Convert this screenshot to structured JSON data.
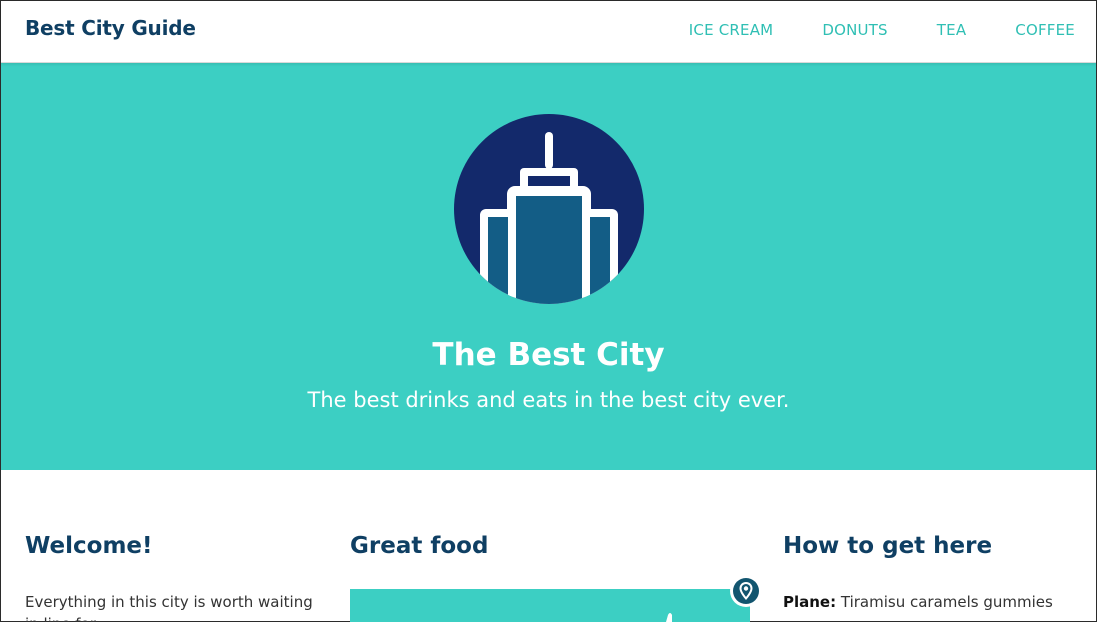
{
  "header": {
    "brand": "Best City Guide",
    "nav": [
      "ICE CREAM",
      "DONUTS",
      "TEA",
      "COFFEE"
    ]
  },
  "hero": {
    "logo_icon": "skyscraper-icon",
    "title": "The Best City",
    "subtitle": "The best drinks and eats in the best city ever."
  },
  "sections": {
    "welcome": {
      "title": "Welcome!",
      "text": "Everything in this city is worth waiting in line for."
    },
    "food": {
      "title": "Great food",
      "pin_icon": "map-pin-icon"
    },
    "get_here": {
      "title": "How to get here",
      "plane_label": "Plane:",
      "plane_text": "Tiramisu caramels gummies"
    }
  },
  "colors": {
    "accent": "#3ccfc3",
    "brand": "#0f3f63",
    "nav": "#2fbfb4",
    "logo_bg": "#13296b",
    "building": "#135d86"
  }
}
